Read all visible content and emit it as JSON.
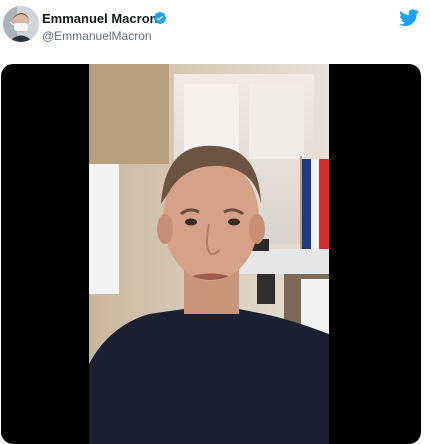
{
  "tweet": {
    "author_name": "Emmanuel Macron",
    "author_handle": "@EmmanuelMacron",
    "verified_icon": "verified-badge-icon",
    "brand_icon": "twitter-bird-icon"
  },
  "colors": {
    "twitter_blue": "#1da1f2",
    "name_text": "#14171a",
    "handle_text": "#5b7083",
    "media_background": "#000000"
  },
  "media": {
    "type": "video",
    "content": "video-frame"
  }
}
